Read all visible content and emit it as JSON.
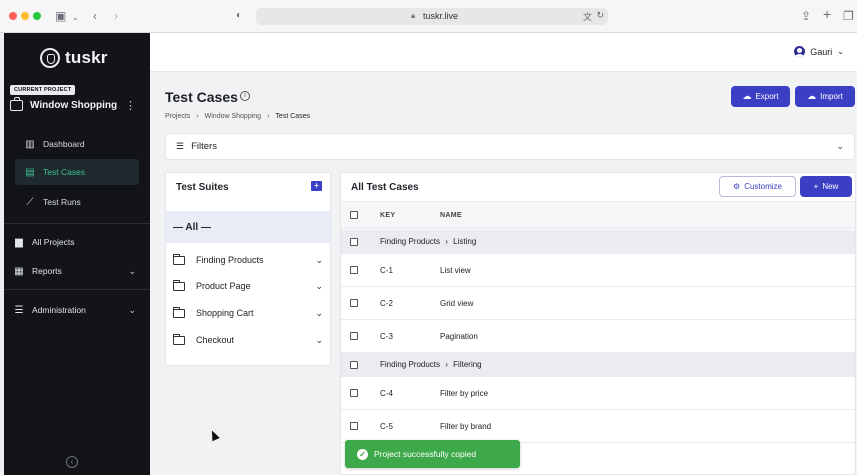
{
  "browser": {
    "url": "tuskr.live",
    "icons": [
      "sidebar-toggle-icon",
      "back-icon",
      "forward-icon",
      "shield-icon",
      "lock-icon",
      "translate-icon",
      "reload-icon",
      "share-icon",
      "new-tab-icon",
      "tabs-icon"
    ]
  },
  "sidebar": {
    "logo_text": "tuskr",
    "current_project_label": "CURRENT PROJECT",
    "project_name": "Window Shopping",
    "project_items": [
      {
        "label": "Dashboard",
        "icon": "chart-icon",
        "active": false
      },
      {
        "label": "Test Cases",
        "icon": "test-cases-icon",
        "active": true
      },
      {
        "label": "Test Runs",
        "icon": "trend-icon",
        "active": false
      }
    ],
    "top_items": [
      {
        "label": "All Projects",
        "icon": "briefcase-icon"
      },
      {
        "label": "Reports",
        "icon": "grid-icon"
      },
      {
        "label": "Administration",
        "icon": "sliders-icon"
      }
    ]
  },
  "header": {
    "user_name": "Gauri"
  },
  "page": {
    "title": "Test Cases",
    "breadcrumb": [
      "Projects",
      "Window Shopping",
      "Test Cases"
    ],
    "export_label": "Export",
    "import_label": "Import",
    "filters_label": "Filters"
  },
  "suites": {
    "title": "Test Suites",
    "all_label": "— All —",
    "items": [
      "Finding Products",
      "Product Page",
      "Shopping Cart",
      "Checkout"
    ]
  },
  "cases": {
    "title": "All Test Cases",
    "customize_label": "Customize",
    "new_label": "New",
    "columns": {
      "key": "KEY",
      "name": "NAME"
    },
    "groups": [
      {
        "parent": "Finding Products",
        "child": "Listing",
        "rows": [
          {
            "key": "C-1",
            "name": "List view"
          },
          {
            "key": "C-2",
            "name": "Grid view"
          },
          {
            "key": "C-3",
            "name": "Pagination"
          }
        ]
      },
      {
        "parent": "Finding Products",
        "child": "Filtering",
        "rows": [
          {
            "key": "C-4",
            "name": "Filter by price"
          },
          {
            "key": "C-5",
            "name": "Filter by brand"
          }
        ]
      }
    ]
  },
  "toast": {
    "message": "Project successfully copied"
  },
  "colors": {
    "primary": "#3b3fc4",
    "sidebar_bg": "#121417",
    "active_green": "#3ec28f",
    "toast_green": "#3ea94a"
  }
}
